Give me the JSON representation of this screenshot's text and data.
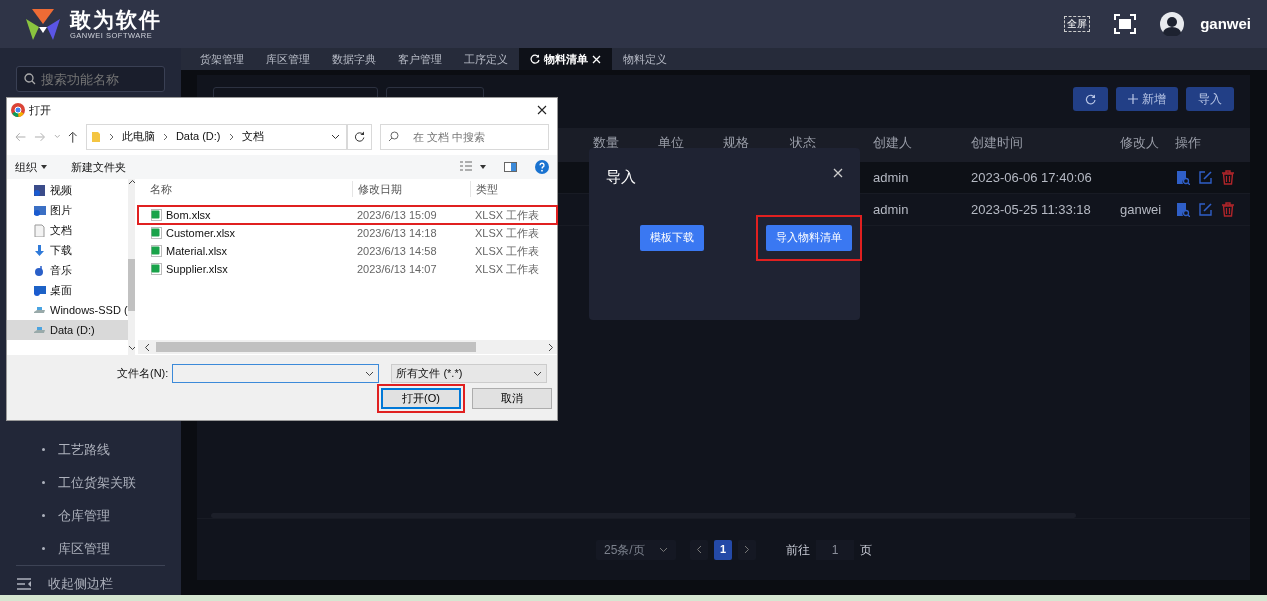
{
  "app": {
    "logo_title": "敢为软件",
    "logo_subtitle": "GANWEI SOFTWARE"
  },
  "header": {
    "fullscreen_label": "全屏",
    "user": "ganwei"
  },
  "sidebar": {
    "search_placeholder": "搜索功能名称",
    "items": [
      {
        "label": "工艺路线"
      },
      {
        "label": "工位货架关联"
      },
      {
        "label": "仓库管理"
      },
      {
        "label": "库区管理"
      }
    ],
    "collapse": "收起侧边栏"
  },
  "tabs": [
    {
      "label": "货架管理",
      "selected": false
    },
    {
      "label": "库区管理",
      "selected": false
    },
    {
      "label": "数据字典",
      "selected": false
    },
    {
      "label": "客户管理",
      "selected": false
    },
    {
      "label": "工序定义",
      "selected": false
    },
    {
      "label": "物料清单",
      "selected": true
    },
    {
      "label": "物料定义",
      "selected": false
    }
  ],
  "toolbar": {
    "buttons": [
      {
        "kind": "refresh"
      },
      {
        "kind": "add",
        "label": "新增"
      },
      {
        "kind": "text",
        "label": "导入"
      }
    ]
  },
  "table": {
    "columns": [
      "数量",
      "单位",
      "规格",
      "状态",
      "创建人",
      "创建时间",
      "修改人",
      "操作"
    ],
    "rows": [
      {
        "creator": "admin",
        "created": "2023-06-06 17:40:06"
      },
      {
        "creator": "admin",
        "created": "2023-05-25 11:33:18",
        "modifier": "ganwei"
      }
    ]
  },
  "pagination": {
    "page_size": "25条/页",
    "pages": [
      {
        "label": "1",
        "selected": true
      }
    ],
    "goto_label": "前往",
    "goto_value": "1",
    "page_suffix": "页"
  },
  "import_modal": {
    "title": "导入",
    "buttons": [
      {
        "label": "模板下载",
        "highlighted": false
      },
      {
        "label": "导入物料清单",
        "highlighted": true
      }
    ]
  },
  "file_dialog": {
    "title": "打开",
    "path": [
      "此电脑",
      "Data (D:)",
      "文档"
    ],
    "search_placeholder": "在 文档 中搜索",
    "toolbar": {
      "organize": "组织",
      "new_folder": "新建文件夹"
    },
    "nav": [
      {
        "label": "视频",
        "kind": "video",
        "selected": false
      },
      {
        "label": "图片",
        "kind": "pictures",
        "selected": false
      },
      {
        "label": "文档",
        "kind": "documents",
        "selected": false
      },
      {
        "label": "下载",
        "kind": "downloads",
        "selected": false
      },
      {
        "label": "音乐",
        "kind": "music",
        "selected": false
      },
      {
        "label": "桌面",
        "kind": "desktop",
        "selected": false
      },
      {
        "label": "Windows-SSD (",
        "kind": "drive",
        "selected": false
      },
      {
        "label": "Data (D:)",
        "kind": "drive",
        "selected": true
      }
    ],
    "columns": [
      "名称",
      "修改日期",
      "类型"
    ],
    "files": [
      {
        "name": "Bom.xlsx",
        "modified": "2023/6/13 15:09",
        "type": "XLSX 工作表",
        "highlighted": true
      },
      {
        "name": "Customer.xlsx",
        "modified": "2023/6/13 14:18",
        "type": "XLSX 工作表",
        "highlighted": false
      },
      {
        "name": "Material.xlsx",
        "modified": "2023/6/13 14:58",
        "type": "XLSX 工作表",
        "highlighted": false
      },
      {
        "name": "Supplier.xlsx",
        "modified": "2023/6/13 14:07",
        "type": "XLSX 工作表",
        "highlighted": false
      }
    ],
    "filename_label": "文件名(N):",
    "filetype": "所有文件 (*.*)",
    "buttons": [
      {
        "label": "打开(O)",
        "highlighted": true
      },
      {
        "label": "取消",
        "highlighted": false
      }
    ]
  }
}
